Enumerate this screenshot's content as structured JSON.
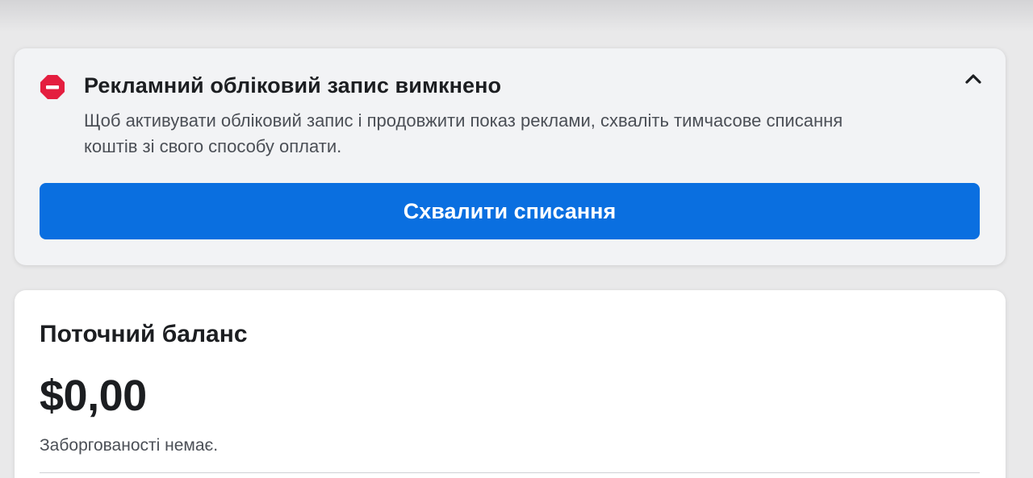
{
  "alert": {
    "icon": "no-entry-icon",
    "title": "Рекламний обліковий запис вимкнено",
    "description": "Щоб активувати обліковий запис і продовжити показ реклами, схваліть тимчасове списання коштів зі свого способу оплати.",
    "collapse_icon": "chevron-up-icon",
    "button_label": "Схвалити списання"
  },
  "balance": {
    "title": "Поточний баланс",
    "amount": "$0,00",
    "note": "Заборгованості немає."
  },
  "colors": {
    "accent": "#0a6fe0",
    "alert_red": "#e41e3f",
    "page_bg": "#e9e9ea"
  }
}
